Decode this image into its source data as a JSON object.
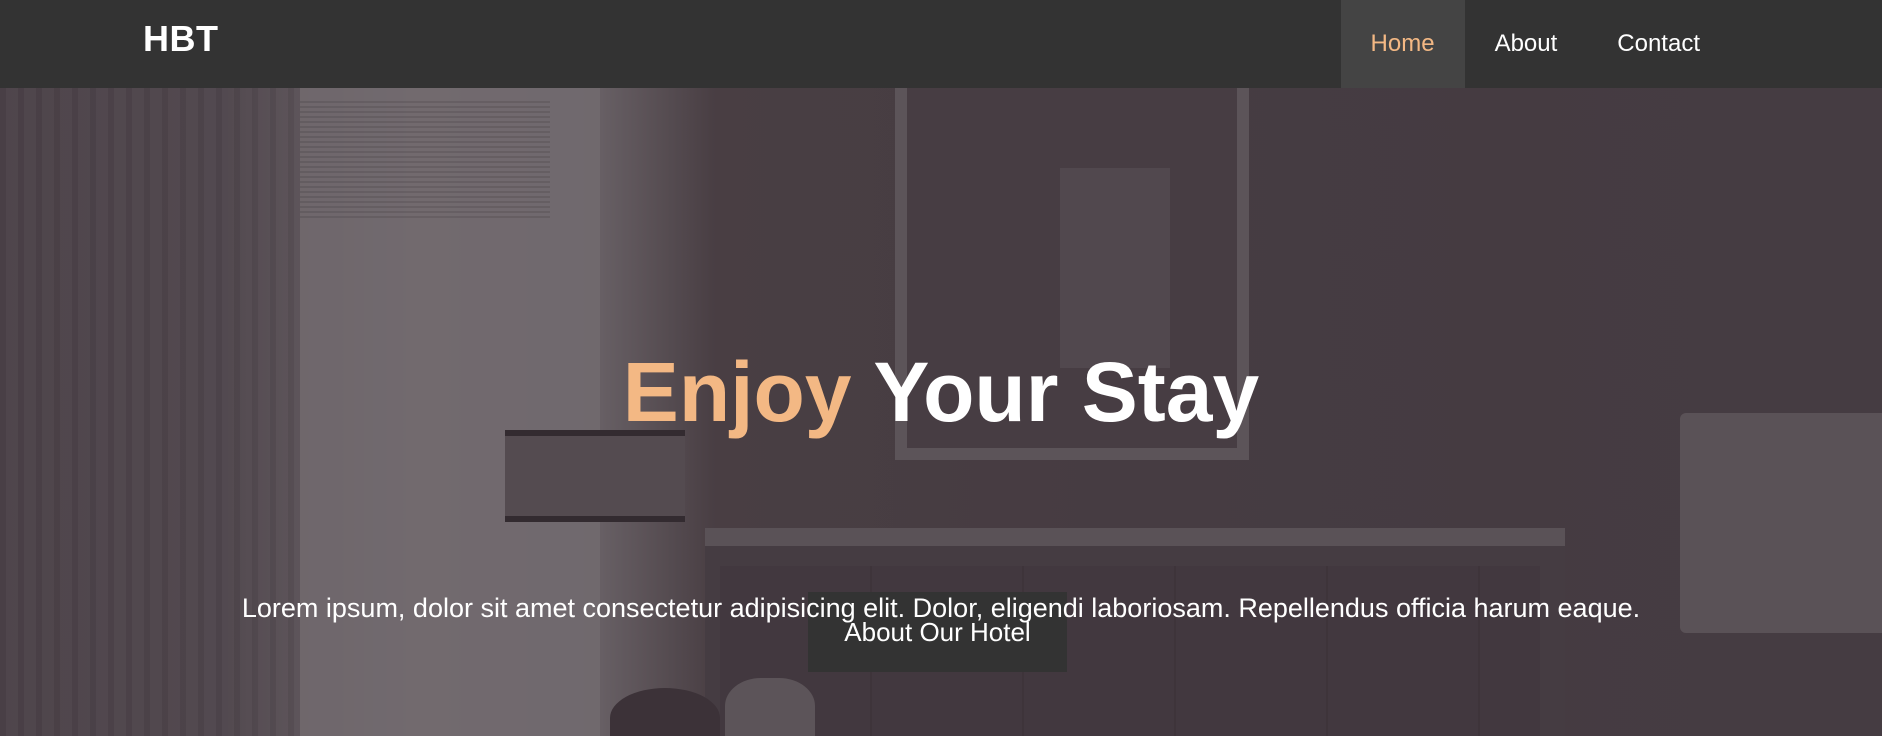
{
  "navbar": {
    "brand": "HBT",
    "links": [
      {
        "label": "Home",
        "active": true
      },
      {
        "label": "About",
        "active": false
      },
      {
        "label": "Contact",
        "active": false
      }
    ]
  },
  "hero": {
    "title_accent": "Enjoy",
    "title_rest": " Your Stay",
    "text": "Lorem ipsum, dolor sit amet consectetur adipisicing elit. Dolor, eligendi laboriosam. Repellendus officia harum eaque.",
    "button_label": "About Our Hotel"
  },
  "colors": {
    "navbar_bg": "#333333",
    "active_nav_bg": "#444444",
    "accent": "#f3b884",
    "text": "#ffffff",
    "button_bg": "#333333"
  }
}
